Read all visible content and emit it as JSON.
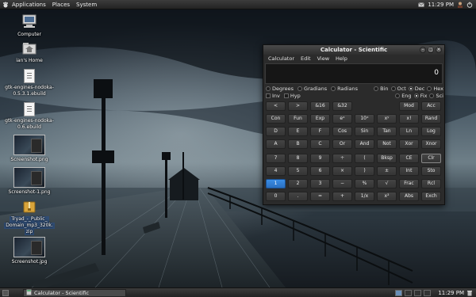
{
  "top_panel": {
    "menus": [
      "Applications",
      "Places",
      "System"
    ],
    "clock": "11:29 PM"
  },
  "desktop": {
    "icons": [
      {
        "label_lines": [
          "Computer"
        ]
      },
      {
        "label_lines": [
          "ian's Home"
        ]
      },
      {
        "label_lines": [
          "gtk-engines-nodoka-",
          "0.5.3.1.ebuild"
        ]
      },
      {
        "label_lines": [
          "gtk-engines-nodoka-",
          "0.6.ebuild"
        ]
      },
      {
        "label_lines": [
          "Screenshot.png"
        ]
      },
      {
        "label_lines": [
          "Screenshot-1.png"
        ]
      },
      {
        "label_lines": [
          "Tryad_-_Public_",
          "Domain_mp3_320k.",
          "zip"
        ]
      },
      {
        "label_lines": [
          "Screenshot.jpg"
        ]
      }
    ]
  },
  "calculator": {
    "title": "Calculator  - Scientific",
    "menus": [
      "Calculator",
      "Edit",
      "View",
      "Help"
    ],
    "display_value": "0",
    "angle_units": [
      "Degrees",
      "Gradians",
      "Radians"
    ],
    "bases": [
      "Bin",
      "Oct",
      "Dec",
      "Hex"
    ],
    "inv_hyp": [
      "Inv",
      "Hyp"
    ],
    "notation": [
      "Eng",
      "Fix",
      "Sci"
    ],
    "buttons": [
      [
        "<",
        ">",
        "&16",
        "&32",
        "Mod",
        "Acc"
      ],
      [
        "Con",
        "Fun",
        "Exp",
        "eˣ",
        "10ˣ",
        "xʸ",
        "x!",
        "Rand"
      ],
      [
        "D",
        "E",
        "F",
        "Cos",
        "Sin",
        "Tan",
        "Ln",
        "Log"
      ],
      [
        "A",
        "B",
        "C",
        "Or",
        "And",
        "Not",
        "Xor",
        "Xnor"
      ],
      [
        "7",
        "8",
        "9",
        "÷",
        "(",
        "Bksp",
        "CE",
        "Clr"
      ],
      [
        "4",
        "5",
        "6",
        "×",
        ")",
        "±",
        "Int",
        "Sto"
      ],
      [
        "1",
        "2",
        "3",
        "−",
        "%",
        "√",
        "Frac",
        "Rcl"
      ],
      [
        "0",
        ".",
        "=",
        "+",
        "1/x",
        "x²",
        "Abs",
        "Exch"
      ]
    ]
  },
  "bottom_panel": {
    "task_label": "Calculator - Scientific",
    "clock": "11:29 PM"
  },
  "colors": {
    "panel": "#2e2e2e",
    "accent": "#2a6fc0"
  }
}
